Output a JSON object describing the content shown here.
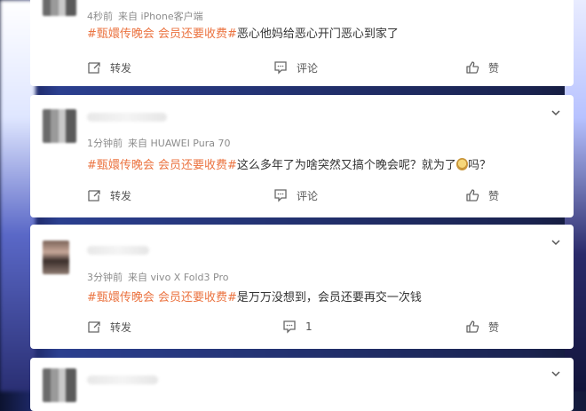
{
  "comments": [
    {
      "time": "4秒前",
      "source": "来自 iPhone客户端",
      "topics": "#甄嬛传晚会 会员还要收费#",
      "text": "恶心他妈给恶心开门恶心到家了",
      "repost_label": "转发",
      "comment_label": "评论",
      "like_label": "赞"
    },
    {
      "time": "1分钟前",
      "source": "来自 HUAWEI Pura 70",
      "topics": "#甄嬛传晚会 会员还要收费#",
      "text_before_emoji": "这么多年了为啥突然又搞个晚会呢？就为了",
      "text_after_emoji": "吗？",
      "repost_label": "转发",
      "comment_label": "评论",
      "like_label": "赞"
    },
    {
      "time": "3分钟前",
      "source": "来自 vivo X Fold3 Pro",
      "topics": "#甄嬛传晚会 会员还要收费#",
      "text": "是万万没想到，会员还要再交一次钱",
      "repost_label": "转发",
      "comment_count": "1",
      "like_label": "赞"
    }
  ],
  "colors": {
    "topic": "#eb7340",
    "text": "#333333",
    "meta": "#8c8c8c"
  }
}
